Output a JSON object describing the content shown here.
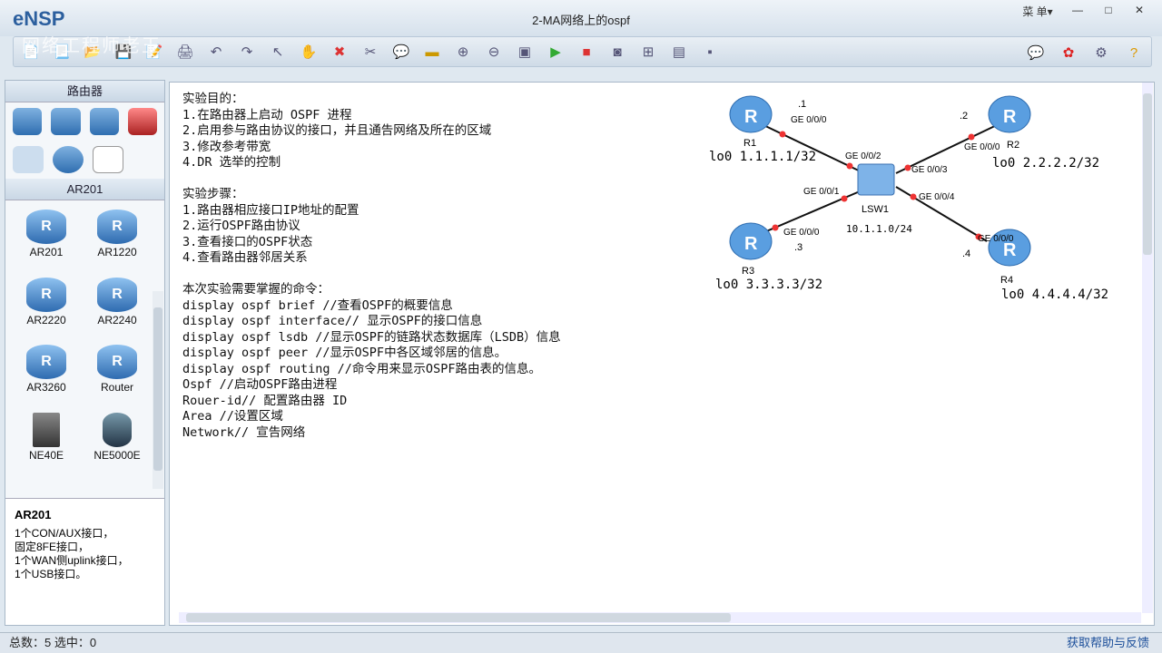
{
  "app": {
    "name": "eNSP",
    "title": "2-MA网络上的ospf",
    "menu": "菜 单▾",
    "watermark": "网络工程师老王"
  },
  "toolbar": {
    "icons": [
      "new-topology",
      "new-lab",
      "open",
      "save",
      "save-as",
      "print",
      "undo",
      "redo",
      "select",
      "pan",
      "delete",
      "delete-link",
      "text",
      "palette",
      "zoom-in",
      "zoom-out",
      "fit",
      "start",
      "stop",
      "capture",
      "topology",
      "grid",
      "console"
    ]
  },
  "left": {
    "category_header": "路由器",
    "model_header": "AR201",
    "devices": [
      "AR201",
      "AR1220",
      "AR2220",
      "AR2240",
      "AR3260",
      "Router",
      "NE40E",
      "NE5000E"
    ],
    "desc_title": "AR201",
    "desc_text": "1个CON/AUX接口，\n固定8FE接口，\n1个WAN侧uplink接口，\n1个USB接口。"
  },
  "notes": [
    "实验目的：",
    "1.在路由器上启动 OSPF 进程",
    "2.启用参与路由协议的接口，并且通告网络及所在的区域",
    "3.修改参考带宽",
    "4.DR 选举的控制",
    "",
    "实验步骤：",
    "1.路由器相应接口IP地址的配置",
    "2.运行OSPF路由协议",
    "3.查看接口的OSPF状态",
    "4.查看路由器邻居关系",
    "",
    "本次实验需要掌握的命令：",
    "display ospf brief //查看OSPF的概要信息",
    "display ospf interface// 显示OSPF的接口信息",
    "display ospf lsdb //显示OSPF的链路状态数据库（LSDB）信息",
    "display ospf peer //显示OSPF中各区域邻居的信息。",
    "display ospf routing //命令用来显示OSPF路由表的信息。",
    "Ospf //启动OSPF路由进程",
    "Rouer-id// 配置路由器 ID",
    "Area //设置区域",
    "Network// 宣告网络"
  ],
  "topology": {
    "switch": {
      "name": "LSW1",
      "subnet": "10.1.1.0/24"
    },
    "routers": [
      {
        "name": "R1",
        "loopback": "lo0 1.1.1.1/32",
        "host": ".1",
        "port": "GE 0/0/0",
        "sw_port": "GE 0/0/2"
      },
      {
        "name": "R2",
        "loopback": "lo0 2.2.2.2/32",
        "host": ".2",
        "port": "GE 0/0/0",
        "sw_port": "GE 0/0/3"
      },
      {
        "name": "R3",
        "loopback": "lo0 3.3.3.3/32",
        "host": ".3",
        "port": "GE 0/0/0",
        "sw_port": "GE 0/0/1"
      },
      {
        "name": "R4",
        "loopback": "lo0 4.4.4.4/32",
        "host": ".4",
        "port": "GE 0/0/0",
        "sw_port": "GE 0/0/4"
      }
    ]
  },
  "status": {
    "summary": "总数：5 选中：0",
    "help": "获取帮助与反馈"
  }
}
